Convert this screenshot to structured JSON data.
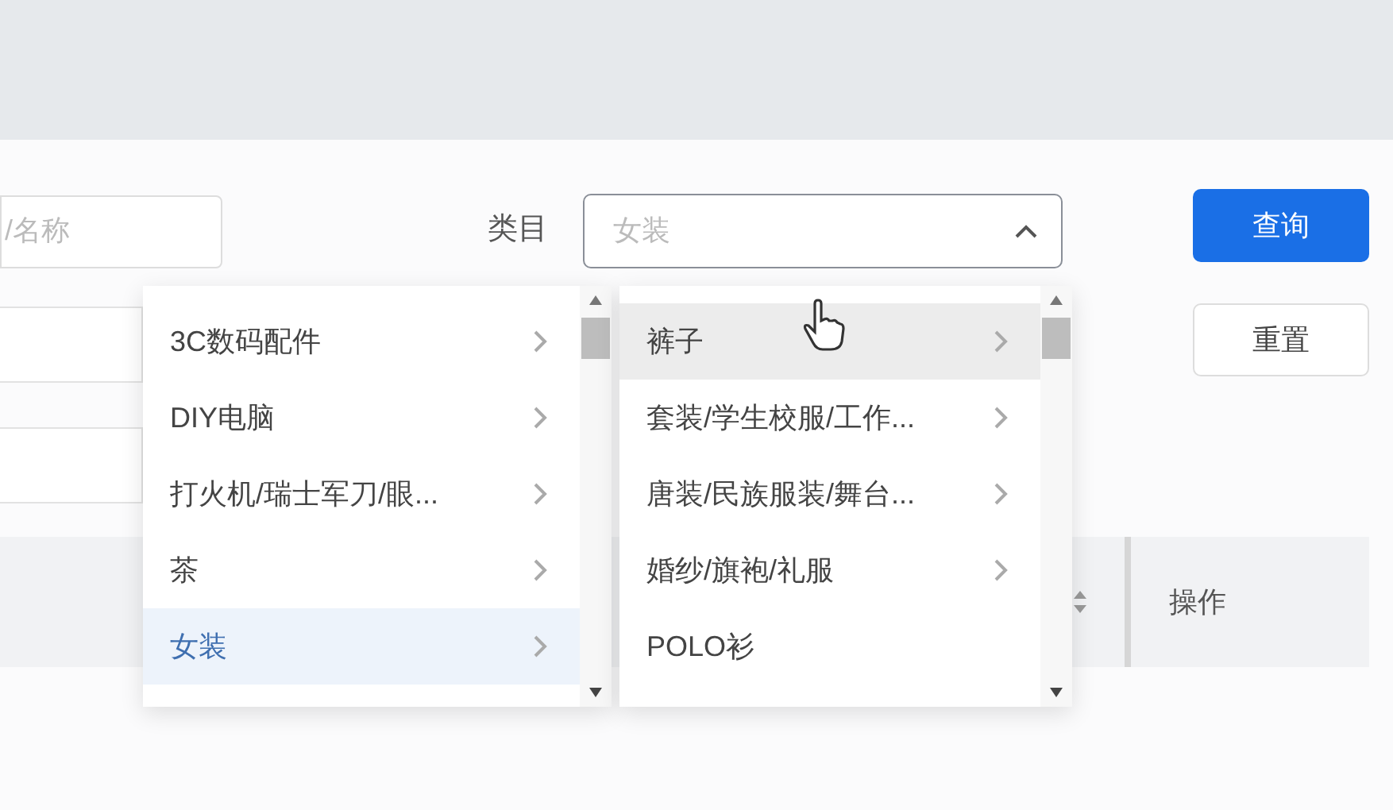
{
  "search": {
    "placeholder": "/名称"
  },
  "category": {
    "label": "类目",
    "placeholder": "女装",
    "expanded": true
  },
  "cascader": {
    "columns": [
      {
        "items": [
          {
            "label": "3C数码配件",
            "has_children": true,
            "selected": false,
            "hovered": false
          },
          {
            "label": "DIY电脑",
            "has_children": true,
            "selected": false,
            "hovered": false
          },
          {
            "label": "打火机/瑞士军刀/眼...",
            "has_children": true,
            "selected": false,
            "hovered": false
          },
          {
            "label": "茶",
            "has_children": true,
            "selected": false,
            "hovered": false
          },
          {
            "label": "女装",
            "has_children": true,
            "selected": true,
            "hovered": false
          }
        ]
      },
      {
        "items": [
          {
            "label": "裤子",
            "has_children": true,
            "selected": false,
            "hovered": true
          },
          {
            "label": "套装/学生校服/工作...",
            "has_children": true,
            "selected": false,
            "hovered": false
          },
          {
            "label": "唐装/民族服装/舞台...",
            "has_children": true,
            "selected": false,
            "hovered": false
          },
          {
            "label": "婚纱/旗袍/礼服",
            "has_children": true,
            "selected": false,
            "hovered": false
          },
          {
            "label": "POLO衫",
            "has_children": false,
            "selected": false,
            "hovered": false
          }
        ]
      }
    ]
  },
  "buttons": [
    {
      "label": "查询",
      "kind": "primary"
    },
    {
      "label": "重置",
      "kind": "default"
    }
  ],
  "table": {
    "columns": [
      {
        "label": "操作"
      }
    ]
  }
}
